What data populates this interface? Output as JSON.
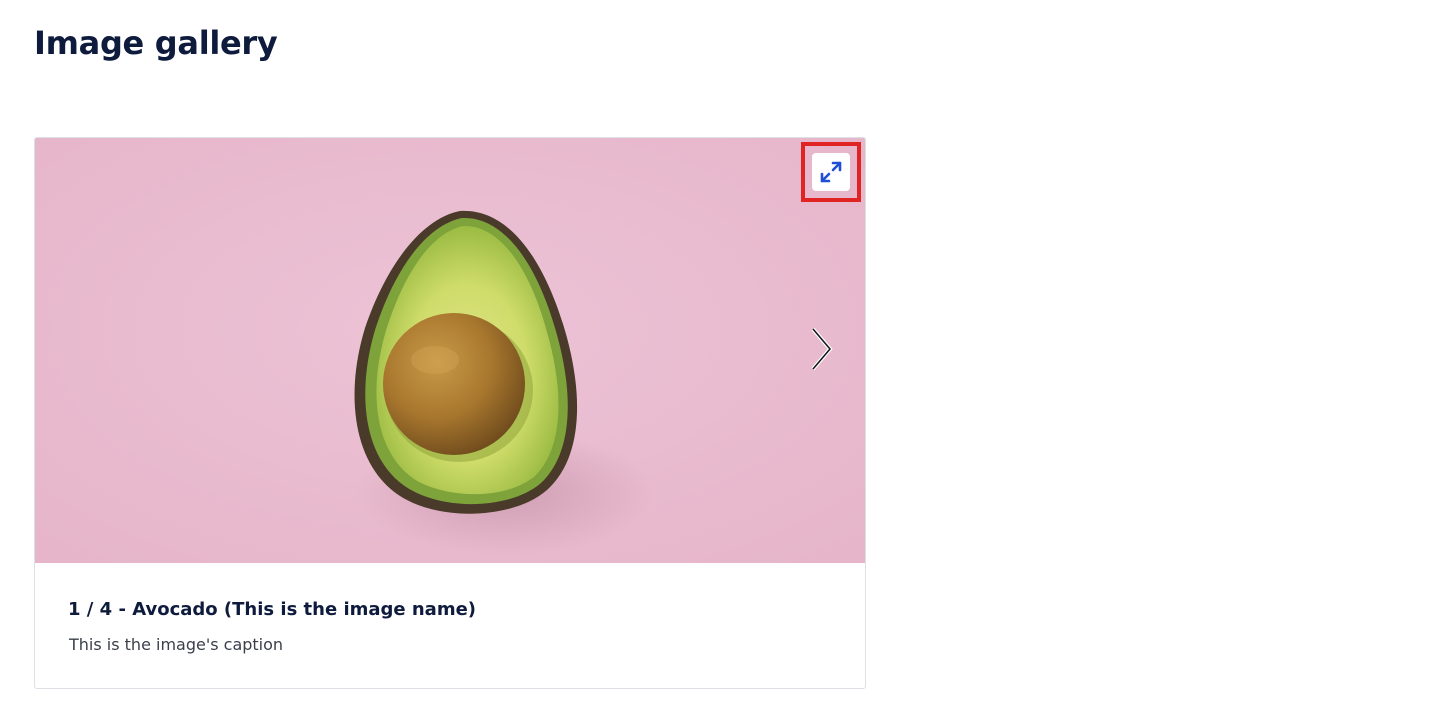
{
  "page": {
    "title": "Image gallery"
  },
  "gallery": {
    "counter": "1 / 4",
    "separator": "-",
    "image_name": "Avocado (This is the image name)",
    "caption": "This is the image's caption",
    "fullscreen_icon": "expand-icon",
    "next_icon": "chevron-right-icon"
  },
  "colors": {
    "background": "#eabcd0",
    "title_text": "#0e1b3d",
    "caption_text": "#3a3f4b",
    "icon_accent": "#1f4fd6",
    "highlight_border": "#e02424"
  }
}
